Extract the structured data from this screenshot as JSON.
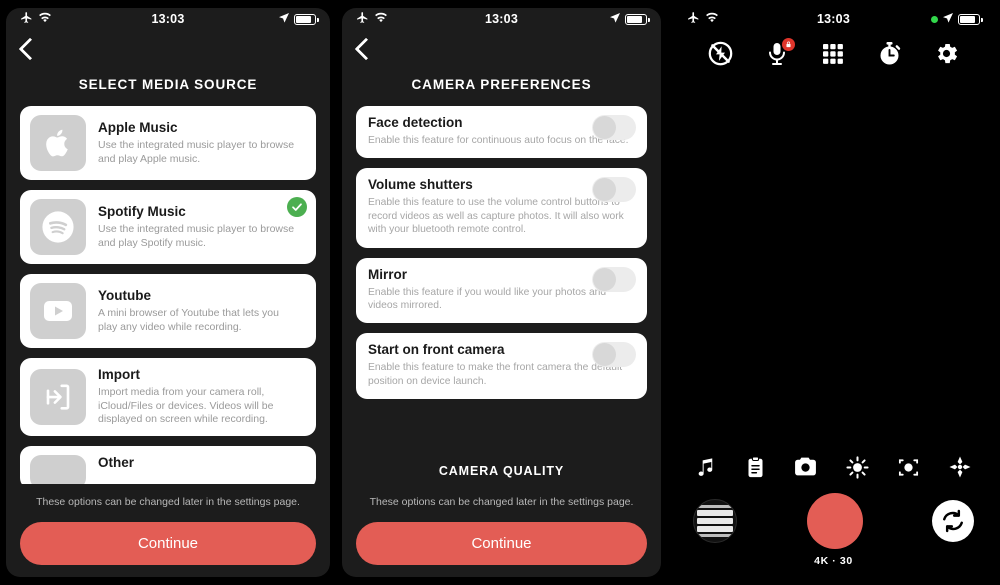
{
  "status_bar": {
    "time": "13:03",
    "airplane_icon": "airplane-mode-icon",
    "wifi_icon": "wifi-icon",
    "location_icon": "location-arrow-icon",
    "battery_icon": "battery-icon",
    "recording_dot": "green-recording-dot"
  },
  "panel_media_source": {
    "back_label": "Back",
    "title": "SELECT MEDIA SOURCE",
    "items": [
      {
        "icon": "apple-logo-icon",
        "title": "Apple Music",
        "desc": "Use the integrated music player to browse and play Apple music.",
        "selected": false
      },
      {
        "icon": "spotify-logo-icon",
        "title": "Spotify Music",
        "desc": "Use the integrated music player  to browse and play Spotify music.",
        "selected": true
      },
      {
        "icon": "youtube-logo-icon",
        "title": "Youtube",
        "desc": "A mini browser of Youtube that lets you play any video while recording.",
        "selected": false
      },
      {
        "icon": "import-arrow-icon",
        "title": "Import",
        "desc": "Import media from your camera roll, iCloud/Files or devices. Videos will be displayed on screen while recording.",
        "selected": false
      },
      {
        "icon": "other-icon",
        "title": "Other",
        "desc": "",
        "selected": false
      }
    ],
    "note": "These options can be changed later in the settings page.",
    "continue_label": "Continue"
  },
  "panel_camera_preferences": {
    "back_label": "Back",
    "title": "CAMERA PREFERENCES",
    "preferences": [
      {
        "title": "Face detection",
        "desc": "Enable this feature for continuous auto focus on the face.",
        "toggle_state": "off"
      },
      {
        "title": "Volume shutters",
        "desc": "Enable this feature to use the volume control buttons to record videos as well as capture photos. It will also work with your bluetooth remote control.",
        "toggle_state": "off"
      },
      {
        "title": "Mirror",
        "desc": "Enable this feature if you would like your photos and videos mirrored.",
        "toggle_state": "off"
      },
      {
        "title": "Start on front camera",
        "desc": "Enable this feature to make the front camera the default position on device launch.",
        "toggle_state": "off"
      }
    ],
    "quality_section_title": "CAMERA QUALITY",
    "note": "These options can be changed later in the settings page.",
    "continue_label": "Continue"
  },
  "panel_camera": {
    "top_tools": [
      {
        "name": "flash-off-icon",
        "label": "Flash off"
      },
      {
        "name": "microphone-locked-icon",
        "label": "Microphone locked"
      },
      {
        "name": "grid-icon",
        "label": "Grid"
      },
      {
        "name": "timer-icon",
        "label": "Timer"
      },
      {
        "name": "settings-gear-icon",
        "label": "Settings"
      }
    ],
    "bottom_tools": [
      {
        "name": "music-note-icon",
        "label": "Music"
      },
      {
        "name": "clipboard-icon",
        "label": "Presets"
      },
      {
        "name": "camera-icon",
        "label": "Photo mode"
      },
      {
        "name": "brightness-icon",
        "label": "Brightness"
      },
      {
        "name": "focus-icon",
        "label": "Focus"
      },
      {
        "name": "stabilization-icon",
        "label": "Stabilization"
      }
    ],
    "gallery_label": "Gallery",
    "shutter_label": "Record",
    "flip_label": "Flip camera",
    "quality_text": "4K · 30"
  },
  "colors": {
    "accent_red": "#e35d55",
    "selected_green": "#4caf50",
    "screen_bg": "#1c1c1c",
    "card_white": "#ffffff",
    "tile_gray": "#cfcfcf",
    "recording_green": "#32d74b",
    "lock_badge_red": "#e0352b"
  }
}
